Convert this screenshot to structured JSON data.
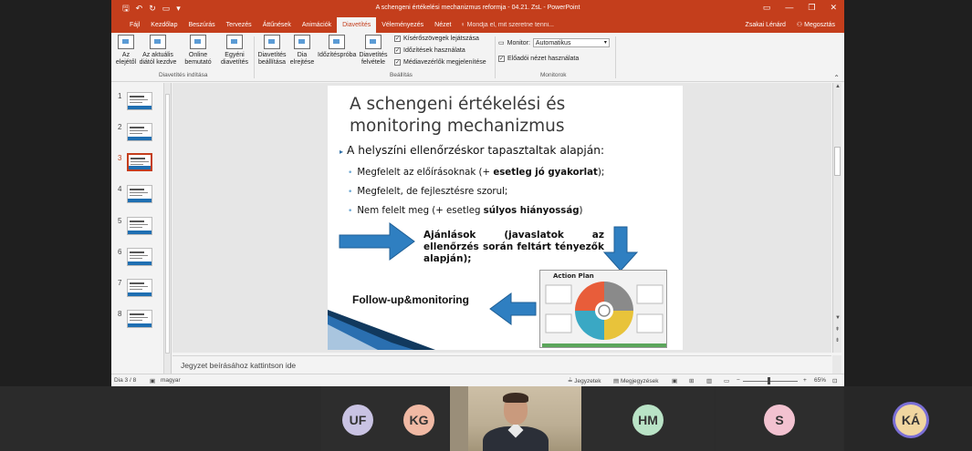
{
  "window": {
    "doc_title": "A schengeni értékelési mechanizmus reformja - 04.21. ZsL - PowerPoint",
    "user_name": "Zsakai Lénárd",
    "share_label": "Megosztás"
  },
  "tabs": [
    {
      "label": "Fájl"
    },
    {
      "label": "Kezdőlap"
    },
    {
      "label": "Beszúrás"
    },
    {
      "label": "Tervezés"
    },
    {
      "label": "Áttűnések"
    },
    {
      "label": "Animációk"
    },
    {
      "label": "Diavetítés"
    },
    {
      "label": "Véleményezés"
    },
    {
      "label": "Nézet"
    }
  ],
  "tell_me": "Mondja el, mit szeretne tenni...",
  "ribbon": {
    "from_start": {
      "l1": "Az",
      "l2": "elejétől"
    },
    "from_current": {
      "l1": "Az aktuális",
      "l2": "diától kezdve"
    },
    "online": {
      "l1": "Online",
      "l2": "bemutató"
    },
    "custom": {
      "l1": "Egyéni",
      "l2": "diavetítés"
    },
    "group_start": "Diavetítés indítása",
    "setup": {
      "l1": "Diavetítés",
      "l2": "beállítása"
    },
    "hide": {
      "l1": "Dia",
      "l2": "elrejtése"
    },
    "rehearse": {
      "l1": "Időzítéspróba"
    },
    "record": {
      "l1": "Diavetítés",
      "l2": "felvétele"
    },
    "chk_narrations": "Kísérőszövegek lejátszása",
    "chk_timings": "Időzítések használata",
    "chk_media": "Médiavezérlők megjelenítése",
    "group_setup": "Beállítás",
    "monitor_label": "Monitor:",
    "monitor_value": "Automatikus",
    "chk_presenter": "Előadói nézet használata",
    "group_monitors": "Monitorok"
  },
  "thumbnails": [
    "1",
    "2",
    "3",
    "4",
    "5",
    "6",
    "7",
    "8"
  ],
  "slide": {
    "title_line1": "A schengeni értékelési és",
    "title_line2": "monitoring mechanizmus",
    "bullet1": "A helyszíni ellenőrzéskor tapasztaltak alapján:",
    "sub1_text": "Megfelelt az előírásoknak (+ ",
    "sub1_bold": "esetleg jó gyakorlat",
    "sub1_end": ");",
    "sub2_text": "Megfelelt, de fejlesztésre szorul;",
    "sub3_text": "Nem felelt meg (+ esetleg ",
    "sub3_bold": "súlyos hiányosság",
    "sub3_end": ")",
    "recommendations": "Ajánlások (javaslatok az ellenőrzés során feltárt tényezők alapján);",
    "follow_up": "Follow-up&monitoring",
    "action_plan_title": "Action Plan"
  },
  "notes_placeholder": "Jegyzet beírásához kattintson ide",
  "status": {
    "slide_info": "Dia 3 / 8",
    "language": "magyar",
    "notes_btn": "Jegyzetek",
    "comments_btn": "Megjegyzések",
    "zoom": "65%"
  },
  "participants": [
    {
      "initials": "UF",
      "color": "#c9c3e3"
    },
    {
      "initials": "KG",
      "color": "#f0b9a4"
    },
    {
      "initials": "HM",
      "color": "#b9e3c6"
    },
    {
      "initials": "S",
      "color": "#f2c2d0"
    },
    {
      "initials": "KÁ",
      "color": "#f0d6a0"
    }
  ],
  "colors": {
    "ppt_accent": "#c43e1c",
    "arrow_blue": "#2f7fc1",
    "speaking_ring": "#7b6fd6"
  }
}
